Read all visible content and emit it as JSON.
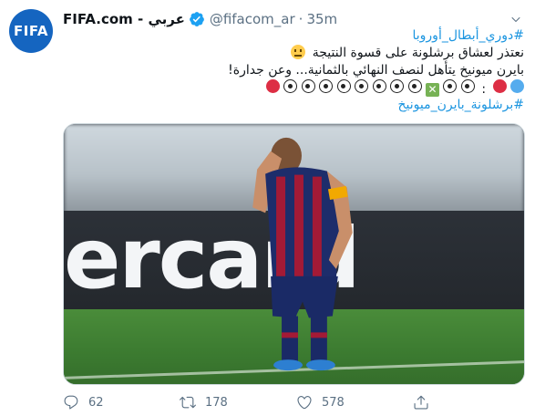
{
  "author": {
    "avatar_text": "FIFA",
    "display_name": "FIFA.com - عربي",
    "handle": "@fifacom_ar",
    "separator": "·",
    "time": "35m"
  },
  "tweet": {
    "hashtag_top": "#دوري_أبطال_أوروبا",
    "line1": "نعتذر لعشاق برشلونة على قسوة النتيجة",
    "line2": "بايرن ميونيخ يتأهل لنصف النهائي بالثمانية... وعن جدارة!",
    "score_colon": ":",
    "hashtag_bottom": "#برشلونة_بايرن_ميونيخ"
  },
  "media": {
    "board_text": "ercard"
  },
  "actions": {
    "replies": "62",
    "retweets": "178",
    "likes": "578"
  },
  "colors": {
    "accent": "#1b95e0",
    "muted": "#5b7083",
    "verified": "#1da1f2"
  },
  "icons": [
    "verified-badge-icon",
    "chevron-down-icon",
    "reply-icon",
    "retweet-icon",
    "like-icon",
    "share-icon"
  ]
}
